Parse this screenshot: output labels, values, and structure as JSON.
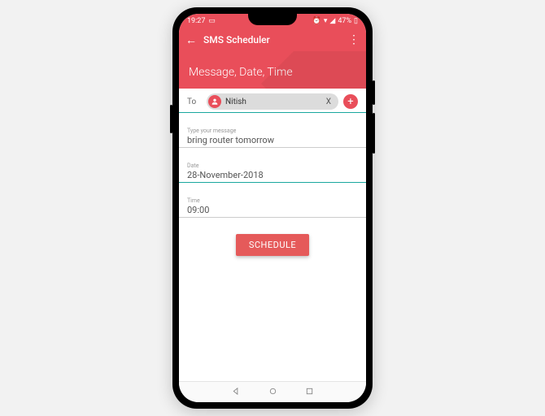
{
  "statusbar": {
    "time": "19:27",
    "battery_pct": "47%"
  },
  "appbar": {
    "title": "SMS Scheduler"
  },
  "header": {
    "title": "Message, Date, Time"
  },
  "form": {
    "to_label": "To",
    "recipient_name": "Nitish",
    "recipient_remove": "X",
    "message_label": "Type your message",
    "message_value": "bring router tomorrow",
    "date_label": "Date",
    "date_value": "28-November-2018",
    "time_label": "Time",
    "time_value": "09:00"
  },
  "actions": {
    "schedule_label": "SCHEDULE"
  }
}
